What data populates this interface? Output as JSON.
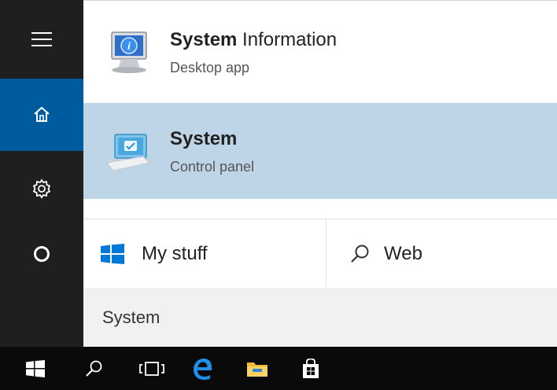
{
  "rail": {
    "items": [
      {
        "name": "menu",
        "icon": "hamburger-icon"
      },
      {
        "name": "home",
        "icon": "home-icon",
        "active": true
      },
      {
        "name": "settings",
        "icon": "gear-icon"
      },
      {
        "name": "cortana",
        "icon": "cortana-circle-icon"
      }
    ]
  },
  "results": [
    {
      "title_bold": "System",
      "title_rest": " Information",
      "subtitle": "Desktop app",
      "icon": "system-information-icon",
      "selected": false
    },
    {
      "title_bold": "System",
      "title_rest": "",
      "subtitle": "Control panel",
      "icon": "system-control-panel-icon",
      "selected": true
    }
  ],
  "scopes": {
    "my_stuff": {
      "label": "My stuff",
      "icon": "windows-logo-icon"
    },
    "web": {
      "label": "Web",
      "icon": "search-icon"
    }
  },
  "query": {
    "value": "System"
  },
  "taskbar": {
    "items": [
      "start-icon",
      "search-icon",
      "task-view-icon",
      "edge-icon",
      "file-explorer-icon",
      "store-icon"
    ]
  },
  "colors": {
    "rail_bg": "#1f1f1f",
    "rail_active": "#005a9e",
    "selected_result": "#bdd5e6",
    "query_bg": "#f1f1f1",
    "taskbar_bg": "#0a0a0a",
    "accent": "#0078d7"
  }
}
